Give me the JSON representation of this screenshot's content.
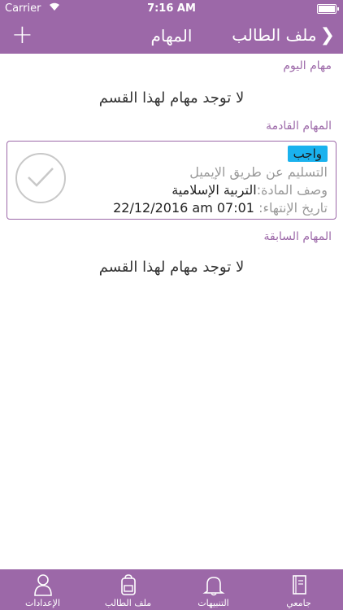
{
  "status_bar": {
    "carrier": "Carrier",
    "time": "7:16 AM"
  },
  "nav": {
    "title": "المهام",
    "back_label": "ملف الطالب",
    "add_label": "+"
  },
  "sections": {
    "today": {
      "header": "مهام اليوم",
      "empty_message": "لا توجد مهام لهذا القسم"
    },
    "upcoming": {
      "header": "المهام القادمة"
    },
    "previous": {
      "header": "المهام السابقة",
      "empty_message": "لا توجد مهام لهذا القسم"
    }
  },
  "task": {
    "badge": "واجب",
    "delivery": "التسليم عن طريق الإيميل",
    "subject_label": "وصف المادة:",
    "subject_value": "التربية الإسلامية",
    "due_label": "تاريخ الإنتهاء:",
    "due_value": "22/12/2016 am 07:01"
  },
  "tabbar": {
    "items": [
      {
        "label": "جامعي",
        "icon": "book-icon"
      },
      {
        "label": "التنبيهات",
        "icon": "bell-icon"
      },
      {
        "label": "ملف الطالب",
        "icon": "backpack-icon"
      },
      {
        "label": "الإعدادات",
        "icon": "user-icon"
      }
    ]
  },
  "colors": {
    "primary": "#9c68a8",
    "badge": "#1ab2ee"
  }
}
